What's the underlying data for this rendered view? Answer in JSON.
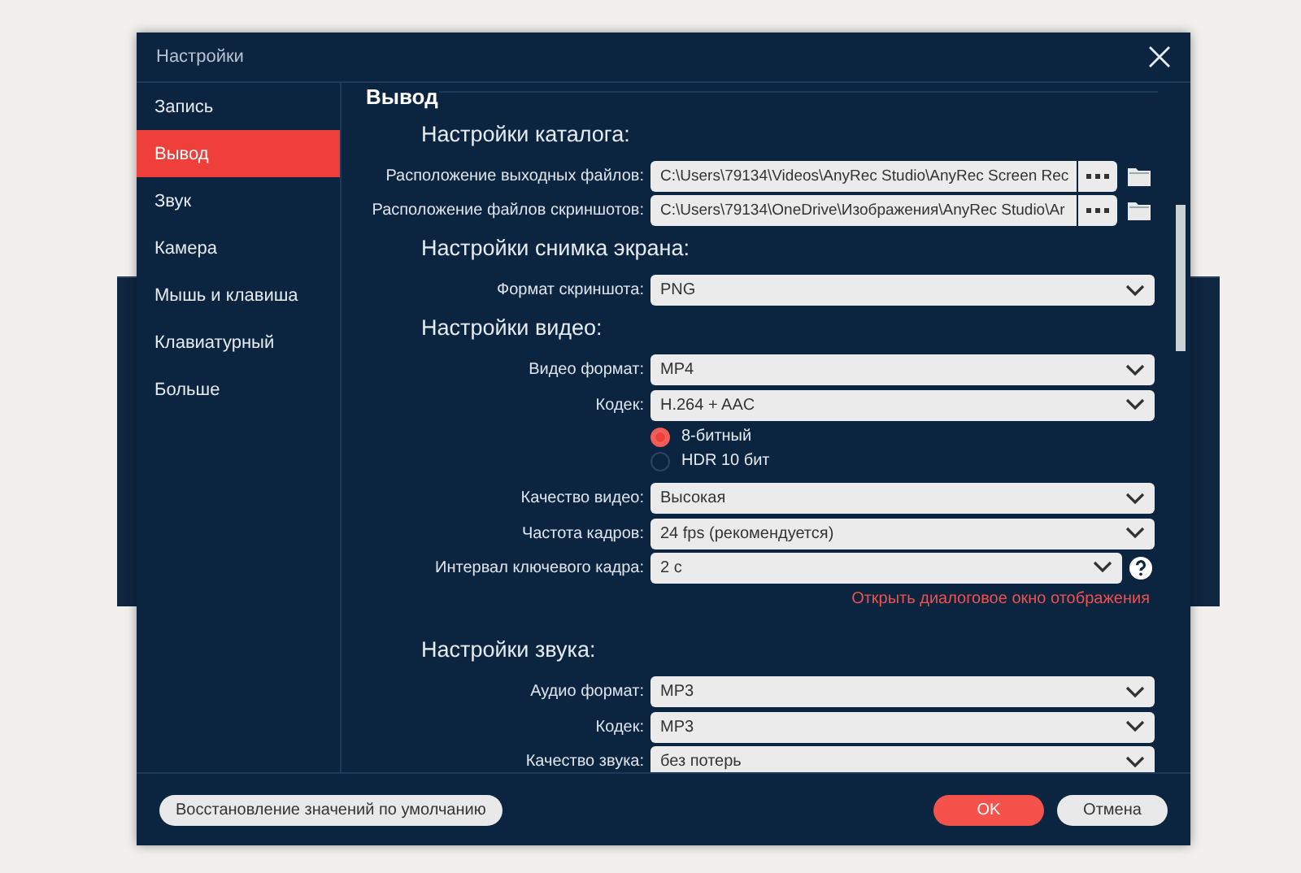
{
  "window": {
    "title": "Настройки"
  },
  "sidebar": {
    "items": [
      {
        "label": "Запись",
        "selected": false
      },
      {
        "label": "Вывод",
        "selected": true
      },
      {
        "label": "Звук",
        "selected": false
      },
      {
        "label": "Камера",
        "selected": false
      },
      {
        "label": "Мышь и клавиша",
        "selected": false
      },
      {
        "label": "Клавиатурный",
        "selected": false
      },
      {
        "label": "Больше",
        "selected": false
      }
    ]
  },
  "content": {
    "section_title": "Вывод",
    "groups": [
      {
        "heading": "Настройки каталога:",
        "rows": [
          {
            "kind": "path",
            "label": "Расположение выходных файлов:",
            "value": "C:\\Users\\79134\\Videos\\AnyRec Studio\\AnyRec Screen Rec"
          },
          {
            "kind": "path",
            "label": "Расположение файлов скриншотов:",
            "value": "C:\\Users\\79134\\OneDrive\\Изображения\\AnyRec Studio\\Ar"
          }
        ]
      },
      {
        "heading": "Настройки снимка экрана:",
        "rows": [
          {
            "kind": "select",
            "label": "Формат скриншота:",
            "value": "PNG"
          }
        ]
      },
      {
        "heading": "Настройки видео:",
        "rows": [
          {
            "kind": "select",
            "label": "Видео формат:",
            "value": "MP4"
          },
          {
            "kind": "select",
            "label": "Кодек:",
            "value": "H.264 + AAC"
          },
          {
            "kind": "radio",
            "options": [
              {
                "label": "8-битный",
                "selected": true
              },
              {
                "label": "HDR 10 бит",
                "selected": false
              }
            ]
          },
          {
            "kind": "select",
            "label": "Качество видео:",
            "value": "Высокая"
          },
          {
            "kind": "select",
            "label": "Частота кадров:",
            "value": "24 fps (рекомендуется)"
          },
          {
            "kind": "select_help",
            "label": "Интервал ключевого кадра:",
            "value": "2 с"
          },
          {
            "kind": "link",
            "text": "Открыть диалоговое окно отображения"
          }
        ]
      },
      {
        "heading": "Настройки звука:",
        "rows": [
          {
            "kind": "select",
            "label": "Аудио формат:",
            "value": "MP3"
          },
          {
            "kind": "select",
            "label": "Кодек:",
            "value": "MP3"
          },
          {
            "kind": "select",
            "label": "Качество звука:",
            "value": "без потерь"
          }
        ]
      }
    ]
  },
  "footer": {
    "reset_button": "Восстановление значений по умолчанию",
    "ok_button": "OK",
    "cancel_button": "Отмена"
  }
}
